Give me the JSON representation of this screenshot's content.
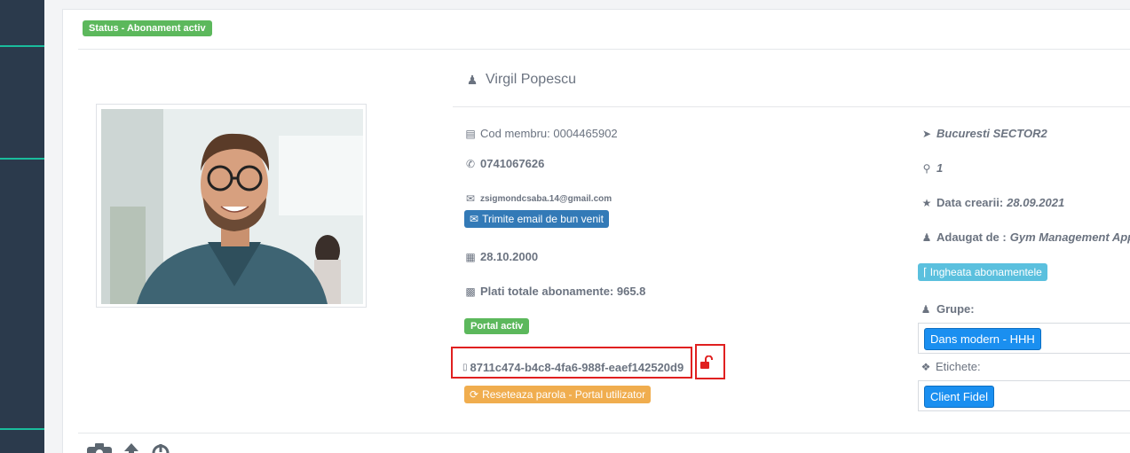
{
  "status_badge": "Status - Abonament activ",
  "member": {
    "name": "Virgil Popescu",
    "cod_membru": "Cod membru: 0004465902",
    "phone": "0741067626",
    "email": "zsigmondcsaba.14@gmail.com",
    "send_email_button": "Trimite email de bun venit",
    "birth_date": "28.10.2000",
    "total_payments": "Plati totale abonamente: 965.8",
    "portal_badge": "Portal activ",
    "portal_uuid": "8711c474-b4c8-4fa6-988f-eaef142520d9",
    "reset_password_button": "Reseteaza parola - Portal utilizator"
  },
  "details": {
    "location": "Bucuresti SECTOR2",
    "location_number": "1",
    "created_label": "Data crearii:",
    "created_value": "28.09.2021",
    "added_by_label": "Adaugat de :",
    "added_by_value": "Gym Management App",
    "freeze_button": "Ingheata abonamentele",
    "groups_label": "Grupe:",
    "groups": [
      "Dans modern - HHH"
    ],
    "tags_label": "Etichete:",
    "tags": [
      "Client Fidel"
    ]
  },
  "icons": {
    "user": "user-icon",
    "card": "credit-card-icon",
    "phone": "phone-icon",
    "email": "envelope-icon",
    "calendar": "calendar-icon",
    "money": "money-icon",
    "mobile": "mobile-icon",
    "unlock": "unlock-icon",
    "refresh": "refresh-icon",
    "location": "location-arrow-icon",
    "pin": "map-marker-icon",
    "star": "star-icon",
    "thermometer": "thermometer-icon",
    "group": "users-icon",
    "tag": "tag-icon",
    "camera": "camera-icon",
    "upload": "upload-icon",
    "power": "power-icon"
  },
  "colors": {
    "sidebar": "#2b3a4c",
    "accent": "#1abc9c",
    "success": "#5cb85c",
    "primary": "#337ab7",
    "info": "#5bc0de",
    "warning": "#f0ad4e",
    "highlight": "#e02020"
  }
}
